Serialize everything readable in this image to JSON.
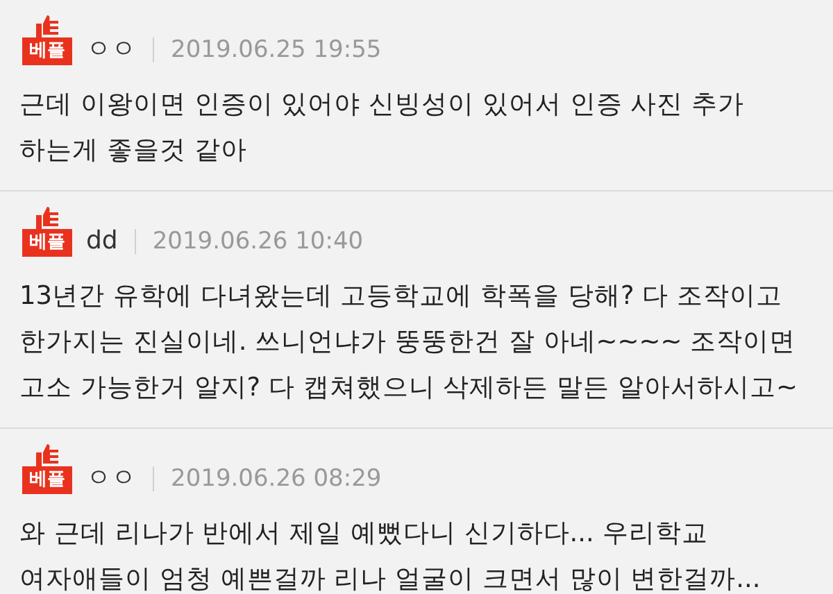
{
  "comments": [
    {
      "badge": "베플",
      "author": "ㅇㅇ",
      "date": "2019.06.25 19:55",
      "text": "근데 이왕이면 인증이 있어야 신빙성이 있어서 인증 사진 추가 하는게 좋을것 같아"
    },
    {
      "badge": "베플",
      "author": "dd",
      "date": "2019.06.26 10:40",
      "text": "13년간 유학에 다녀왔는데 고등학교에 학폭을 당해? 다 조작이고 한가지는 진실이네. 쓰니언냐가 뚱뚱한건 잘 아네~~~~ 조작이면 고소 가능한거 알지? 다 캡쳐했으니 삭제하든 말든 알아서하시고~"
    },
    {
      "badge": "베플",
      "author": "ㅇㅇ",
      "date": "2019.06.26 08:29",
      "text": "와 근데 리나가 반에서 제일 예뻤다니 신기하다... 우리학교 여자애들이 엄청 예쁜걸까 리나 얼굴이 크면서 많이 변한걸까..."
    }
  ]
}
